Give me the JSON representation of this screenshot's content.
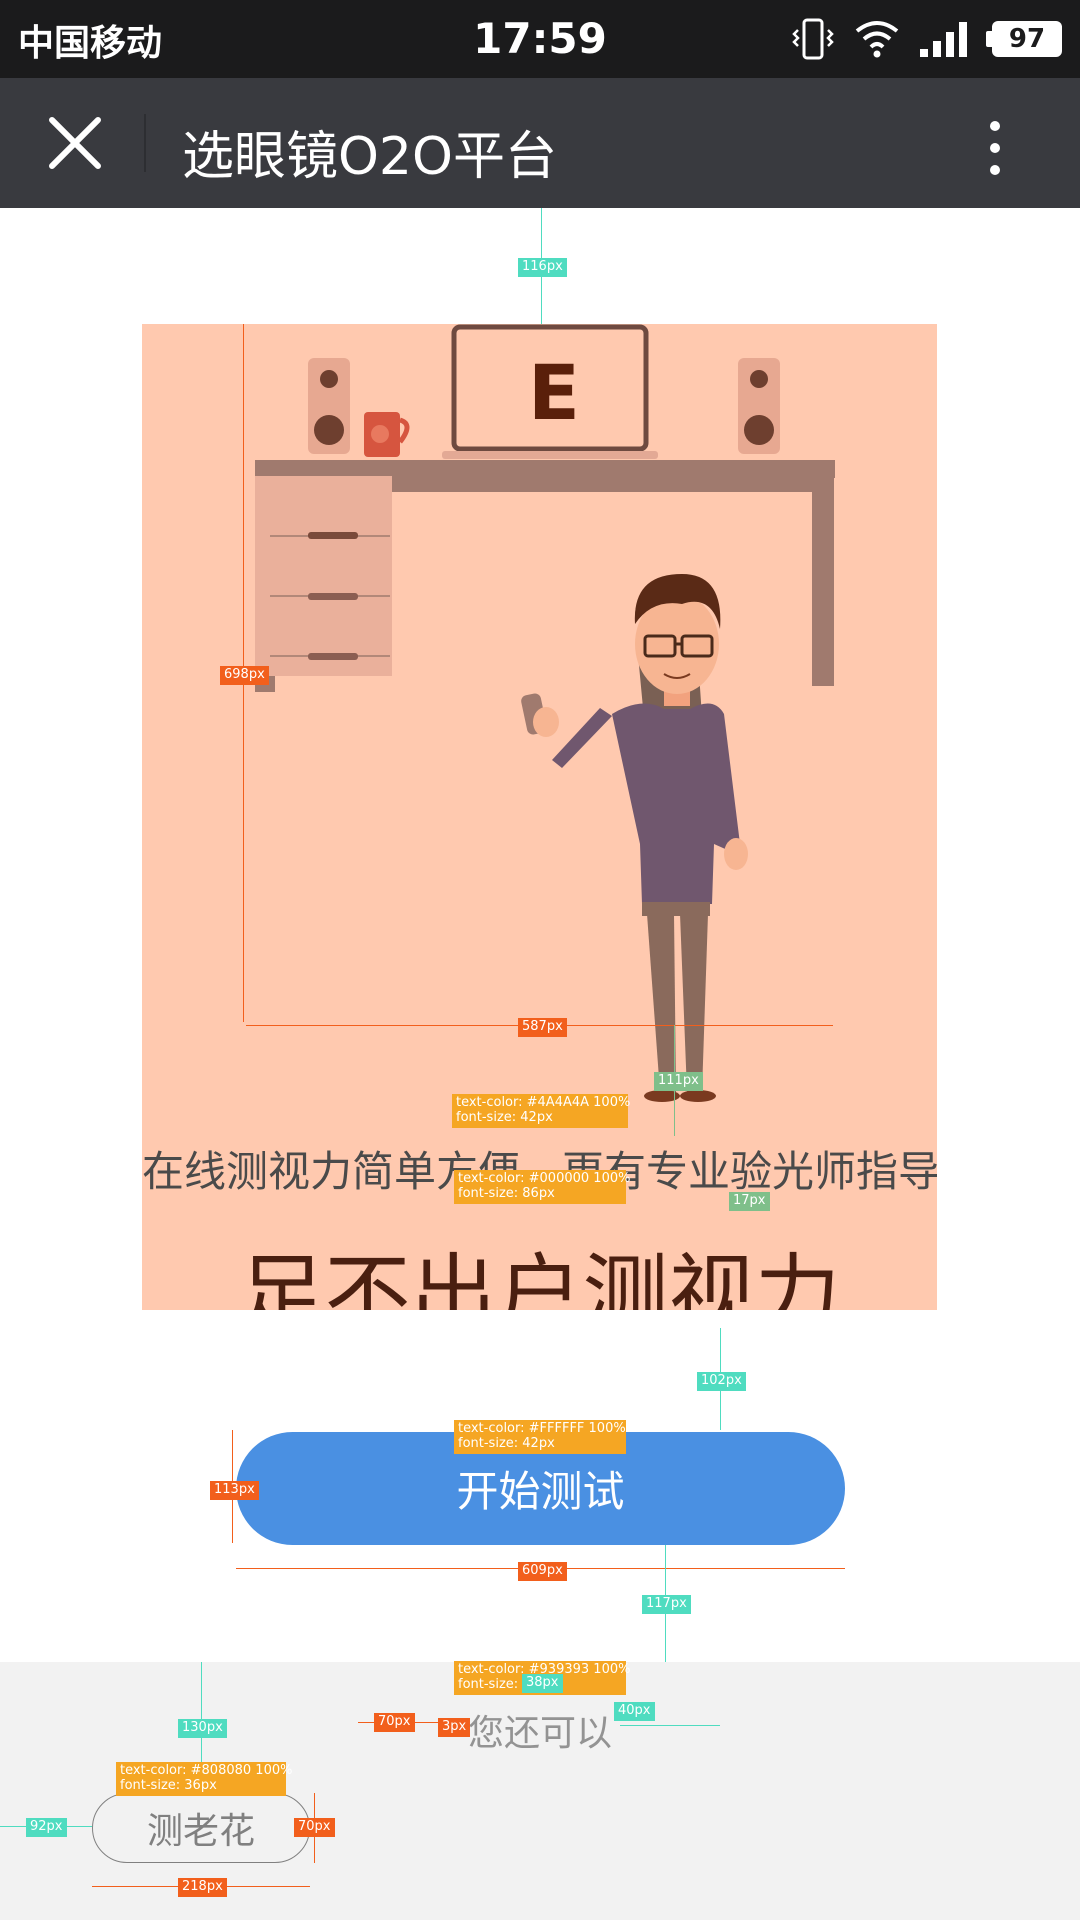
{
  "status_bar": {
    "carrier": "中国移动",
    "time": "17:59",
    "battery": "97"
  },
  "header": {
    "title": "选眼镜O2O平台",
    "close_icon": "close-icon",
    "more_icon": "more-vertical-icon"
  },
  "hero": {
    "monitor_letter": "E",
    "subtitle": "在线测视力简单方便，更有专业验光师指导",
    "headline": "足不出户测视力"
  },
  "start_button": {
    "label": "开始测试"
  },
  "more_section": {
    "label": "您还可以",
    "button_label": "测老花"
  },
  "annotations": {
    "a1": "116px",
    "a2": "698px",
    "a3": "587px",
    "a4": "111px",
    "a5_line1": "text-color: #4A4A4A 100%",
    "a5_line2": "font-size: 42px",
    "a6_line1": "text-color: #000000 100%",
    "a6_line2": "font-size: 86px",
    "a7": "17px",
    "a8": "102px",
    "a9_line1": "text-color: #FFFFFF 100%",
    "a9_line2": "font-size: 42px",
    "a10": "113px",
    "a11": "609px",
    "a12": "117px",
    "a13_line1": "text-color: #939393 100%",
    "a13_line2": "font-size:",
    "a14": "38px",
    "a15": "70px",
    "a16": "3px",
    "a17": "40px",
    "a18": "130px",
    "a19_line1": "text-color: #808080 100%",
    "a19_line2": "font-size: 36px",
    "a20": "92px",
    "a21": "70px",
    "a22": "218px"
  },
  "colors": {
    "status_bar": "#1b1b1c",
    "header": "#393a3f",
    "panel": "#ffc9af",
    "button": "#4a90e2",
    "bottom": "#f2f2f2"
  }
}
